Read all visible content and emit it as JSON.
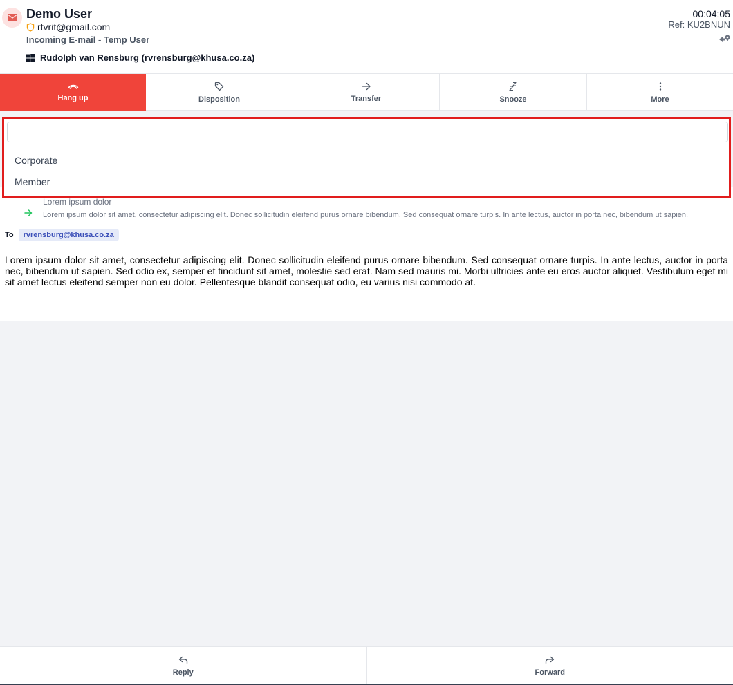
{
  "header": {
    "title": "Demo User",
    "email": "rtvrit@gmail.com",
    "subtitle": "Incoming E-mail - Temp User",
    "agent": "Rudolph van Rensburg (rvrensburg@khusa.co.za)",
    "timer": "00:04:05",
    "ref": "Ref: KU2BNUN"
  },
  "toolbar": {
    "items": [
      {
        "label": "Hang up",
        "icon": "hang-up-icon"
      },
      {
        "label": "Disposition",
        "icon": "tag-icon"
      },
      {
        "label": "Transfer",
        "icon": "arrow-right-icon"
      },
      {
        "label": "Snooze",
        "icon": "snooze-icon"
      },
      {
        "label": "More",
        "icon": "more-vertical-icon"
      }
    ]
  },
  "dropdown": {
    "search_value": "",
    "options": [
      "Corporate",
      "Member"
    ]
  },
  "email": {
    "subject": "Lorem ipsum dolor",
    "preview": "Lorem ipsum dolor sit amet, consectetur adipiscing elit. Donec sollicitudin eleifend purus ornare bibendum. Sed consequat ornare turpis. In ante lectus, auctor in porta nec, bibendum ut sapien.",
    "to_label": "To",
    "to_address": "rvrensburg@khusa.co.za",
    "body": "Lorem ipsum dolor sit amet, consectetur adipiscing elit. Donec sollicitudin eleifend purus ornare bibendum. Sed consequat ornare turpis. In ante lectus, auctor in porta nec, bibendum ut sapien. Sed odio ex, semper et tincidunt sit amet, molestie sed erat. Nam sed mauris mi. Morbi ultricies ante eu eros auctor aliquet. Vestibulum eget mi sit amet lectus eleifend semper non eu dolor. Pellentesque blandit consequat odio, eu varius nisi commodo at."
  },
  "bottom": {
    "reply_label": "Reply",
    "forward_label": "Forward"
  },
  "colors": {
    "accent": "#f0443a",
    "highlight_border": "#e11d1d",
    "chip_bg": "#e5eaf8",
    "chip_text": "#3b4fb8"
  }
}
